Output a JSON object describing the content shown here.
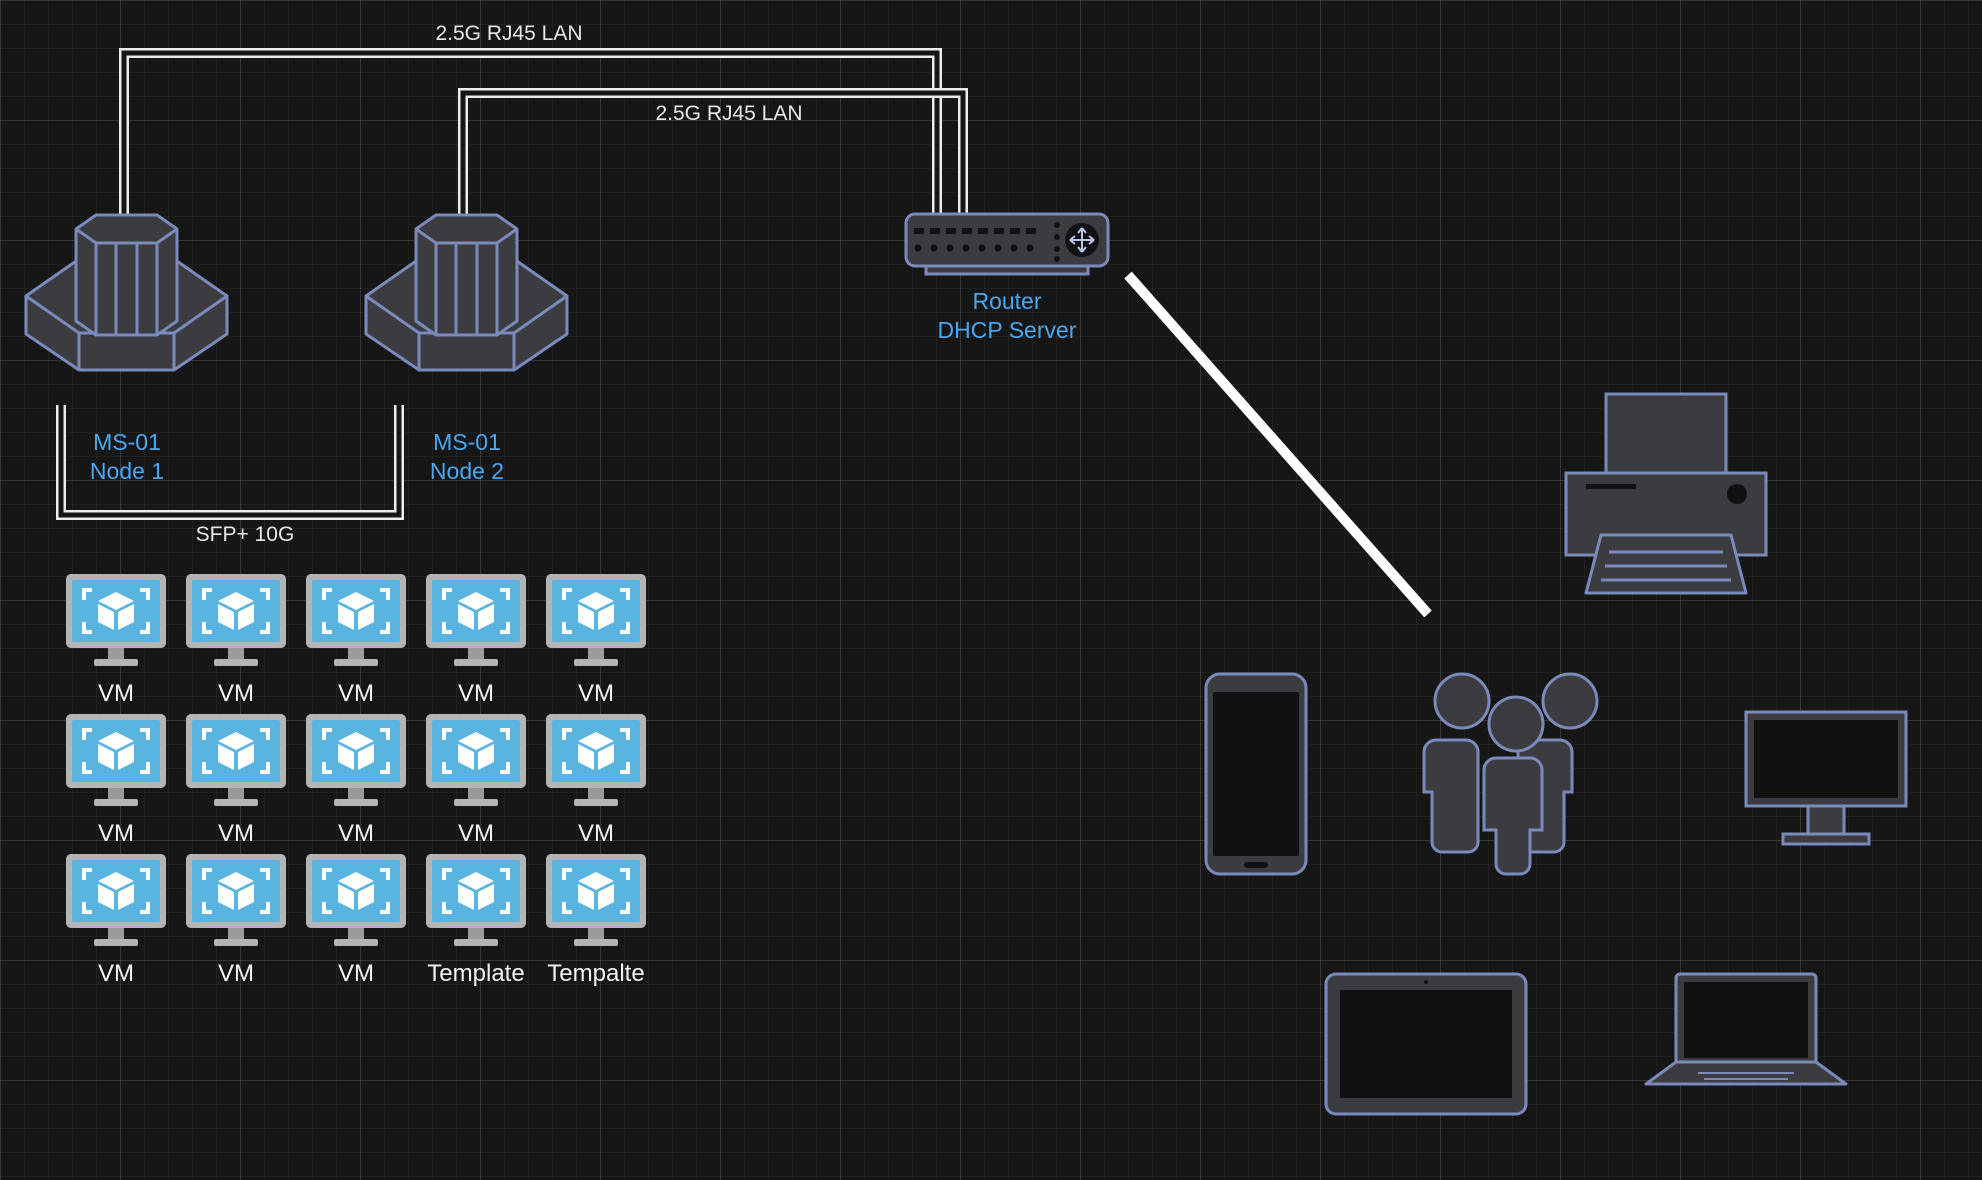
{
  "links": {
    "lan_top": "2.5G RJ45 LAN",
    "lan_inner": "2.5G RJ45 LAN",
    "sfp": "SFP+ 10G"
  },
  "nodes": [
    {
      "name": "MS-01",
      "sub": "Node 1"
    },
    {
      "name": "MS-01",
      "sub": "Node 2"
    }
  ],
  "router": {
    "line1": "Router",
    "line2": "DHCP Server"
  },
  "vms": {
    "row1": [
      "VM",
      "VM",
      "VM",
      "VM",
      "VM"
    ],
    "row2": [
      "VM",
      "VM",
      "VM",
      "VM",
      "VM"
    ],
    "row3": [
      "VM",
      "VM",
      "VM",
      "Template",
      "Tempalte"
    ]
  },
  "devices": [
    "printer-icon",
    "phone-icon",
    "users-icon",
    "monitor-icon",
    "tablet-icon",
    "laptop-icon"
  ],
  "colors": {
    "background": "#161616",
    "node_label": "#4aa8f0",
    "icon_fill": "#3c3c40",
    "icon_stroke": "#7a8bbb",
    "vm_screen": "#5ab4e0"
  }
}
